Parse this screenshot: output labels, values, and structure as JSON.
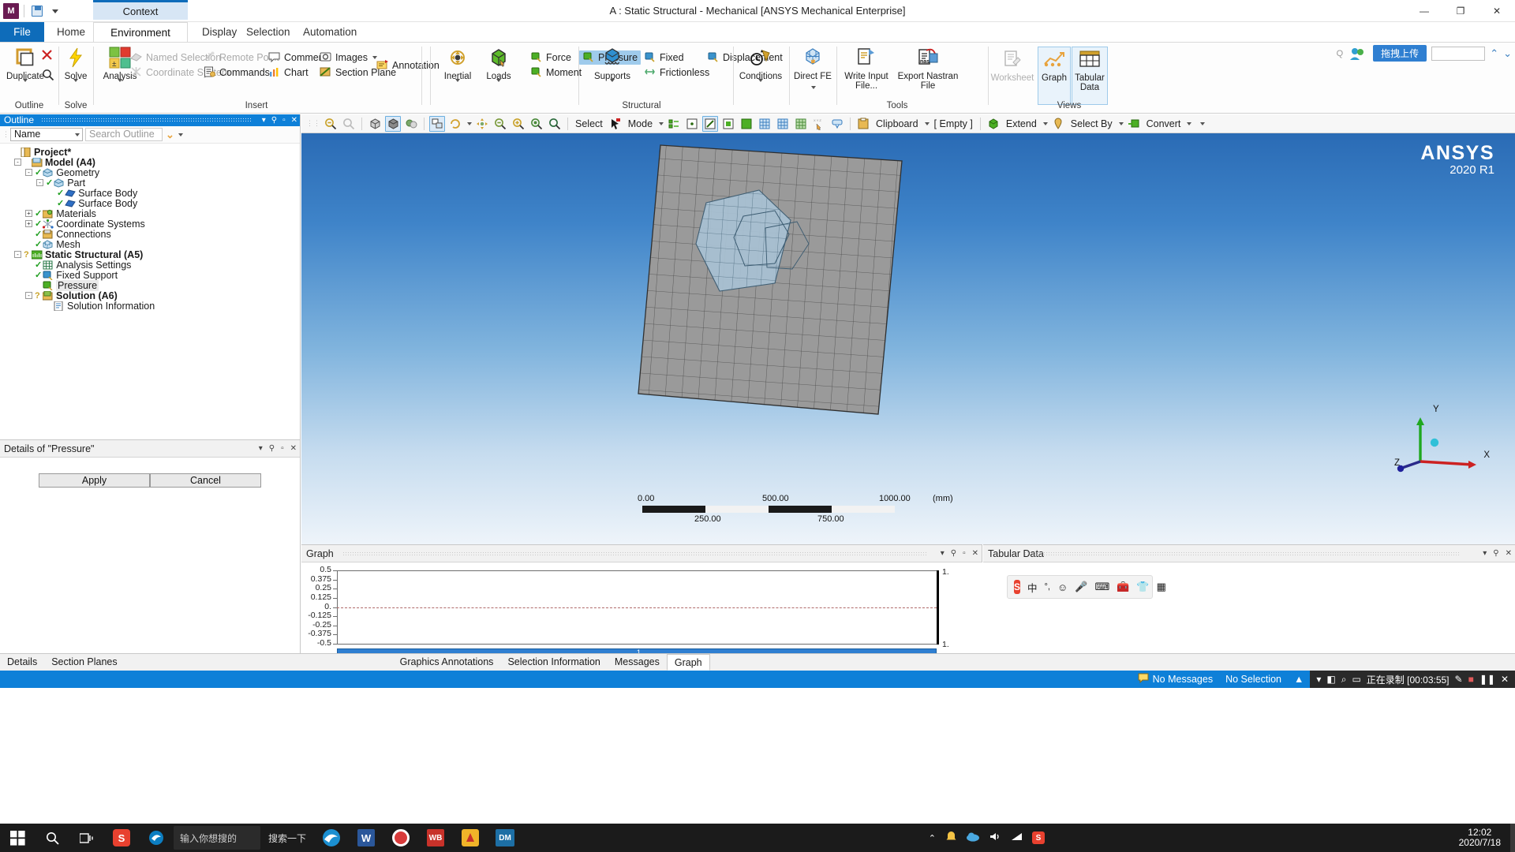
{
  "window": {
    "title": "A : Static Structural - Mechanical [ANSYS Mechanical Enterprise]",
    "context_tab": "Context",
    "minimize": "—",
    "maximize": "❐",
    "close": "✕"
  },
  "ribbon": {
    "tabs": [
      {
        "label": "File",
        "active": false
      },
      {
        "label": "Home",
        "active": false
      },
      {
        "label": "Environment",
        "active": true
      },
      {
        "label": "Display",
        "active": false
      },
      {
        "label": "Selection",
        "active": false
      },
      {
        "label": "Automation",
        "active": false
      }
    ],
    "groups": [
      {
        "label": "Outline"
      },
      {
        "label": "Solve"
      },
      {
        "label": "Insert"
      },
      {
        "label": "Structural"
      },
      {
        "label": "Tools"
      },
      {
        "label": "Views"
      }
    ],
    "outline_group": {
      "duplicate": "Duplicate",
      "delete_icon": "delete-icon",
      "find_icon": "find-icon"
    },
    "solve_group": {
      "solve": "Solve",
      "solve_label": "Solve"
    },
    "insert_group": {
      "analysis": "Analysis",
      "named_selection": "Named Selection",
      "coordinate_system": "Coordinate System",
      "remote_point": "Remote Point",
      "commands": "Commands",
      "comment": "Comment",
      "chart": "Chart",
      "images": "Images",
      "section_plane": "Section Plane",
      "annotation": "Annotation"
    },
    "structural_group": {
      "inertial": "Inertial",
      "loads": "Loads",
      "force": "Force",
      "moment": "Moment",
      "pressure": "Pressure",
      "supports": "Supports",
      "fixed": "Fixed",
      "frictionless": "Frictionless",
      "displacement": "Displacement",
      "conditions": "Conditions",
      "direct_fe": "Direct FE"
    },
    "tools_group": {
      "write_input_file": "Write Input File...",
      "export_nastran_file": "Export Nastran File",
      "nas_badge": ".nas",
      "worksheet": "Worksheet"
    },
    "views_group": {
      "graph": "Graph",
      "tabular_data": "Tabular Data"
    }
  },
  "outline_panel": {
    "title": "Outline",
    "filter_value": "Name",
    "search_placeholder": "Search Outline",
    "tree": [
      {
        "label": "Project*",
        "depth": 0,
        "bold": true,
        "expander": "",
        "status": "",
        "icon": "project-icon"
      },
      {
        "label": "Model (A4)",
        "depth": 1,
        "bold": true,
        "expander": "-",
        "status": "",
        "icon": "model-icon"
      },
      {
        "label": "Geometry",
        "depth": 2,
        "bold": false,
        "expander": "-",
        "status": "check",
        "icon": "geometry-icon"
      },
      {
        "label": "Part",
        "depth": 3,
        "bold": false,
        "expander": "-",
        "status": "check",
        "icon": "part-icon"
      },
      {
        "label": "Surface Body",
        "depth": 4,
        "bold": false,
        "expander": "",
        "status": "check",
        "icon": "surface-body-icon"
      },
      {
        "label": "Surface Body",
        "depth": 4,
        "bold": false,
        "expander": "",
        "status": "check",
        "icon": "surface-body-icon"
      },
      {
        "label": "Materials",
        "depth": 2,
        "bold": false,
        "expander": "+",
        "status": "check",
        "icon": "materials-icon"
      },
      {
        "label": "Coordinate Systems",
        "depth": 2,
        "bold": false,
        "expander": "+",
        "status": "check",
        "icon": "coordinate-systems-icon"
      },
      {
        "label": "Connections",
        "depth": 2,
        "bold": false,
        "expander": "",
        "status": "check",
        "icon": "connections-icon"
      },
      {
        "label": "Mesh",
        "depth": 2,
        "bold": false,
        "expander": "",
        "status": "check",
        "icon": "mesh-icon"
      },
      {
        "label": "Static Structural (A5)",
        "depth": 1,
        "bold": true,
        "expander": "-",
        "status": "question",
        "icon": "static-structural-icon"
      },
      {
        "label": "Analysis Settings",
        "depth": 2,
        "bold": false,
        "expander": "",
        "status": "check",
        "icon": "analysis-settings-icon"
      },
      {
        "label": "Fixed Support",
        "depth": 2,
        "bold": false,
        "expander": "",
        "status": "check",
        "icon": "fixed-support-icon"
      },
      {
        "label": "Pressure",
        "depth": 2,
        "bold": false,
        "expander": "",
        "status": "",
        "icon": "pressure-icon",
        "selected": true
      },
      {
        "label": "Solution (A6)",
        "depth": 2,
        "bold": true,
        "expander": "-",
        "status": "question",
        "icon": "solution-icon"
      },
      {
        "label": "Solution Information",
        "depth": 3,
        "bold": false,
        "expander": "",
        "status": "",
        "icon": "solution-information-icon"
      }
    ]
  },
  "details_panel": {
    "title": "Details of \"Pressure\"",
    "apply_label": "Apply",
    "cancel_label": "Cancel"
  },
  "graphics_toolbar": {
    "select_label": "Select",
    "mode_label": "Mode",
    "clipboard_label": "Clipboard",
    "empty_label": "[ Empty ]",
    "extend_label": "Extend",
    "select_by_label": "Select By",
    "convert_label": "Convert"
  },
  "graphics": {
    "brand_line1": "ANSYS",
    "brand_line2": "2020 R1",
    "axis_x": "X",
    "axis_y": "Y",
    "axis_z": "Z",
    "scale_unit": "(mm)",
    "scale_major": [
      "0.00",
      "500.00",
      "1000.00"
    ],
    "scale_minor": [
      "250.00",
      "750.00"
    ]
  },
  "graph_panel": {
    "title": "Graph",
    "x_right_top": "1.",
    "x_right_bottom": "1.",
    "bar_label": "1"
  },
  "tabular_panel": {
    "title": "Tabular Data"
  },
  "ime": {
    "logo": "S",
    "lang": "中",
    "punct": "°,",
    "emoji": "☺",
    "mic": "mic-icon",
    "keyboard": "keyboard-icon",
    "toolbox": "toolbox-icon",
    "skin": "skin-icon",
    "grid": "grid-icon"
  },
  "bottom_tabs": [
    {
      "label": "Details",
      "active": false
    },
    {
      "label": "Section Planes",
      "active": false
    },
    {
      "label": "Graphics Annotations",
      "active": false
    },
    {
      "label": "Selection Information",
      "active": false
    },
    {
      "label": "Messages",
      "active": false
    },
    {
      "label": "Graph",
      "active": true
    }
  ],
  "status_bar": {
    "messages": "No Messages",
    "selection": "No Selection",
    "recording": "正在录制 [00:03:55]"
  },
  "upload_badge": "拖拽上传",
  "taskbar": {
    "search_placeholder": "输入你想搜的",
    "search_button": "搜索一下",
    "time": "12:02",
    "date": "2020/7/18",
    "apps": [
      "sogou-icon",
      "edge-icon",
      "word-icon",
      "record-icon",
      "wps-icon",
      "ansys-icon",
      "designmodeler-icon"
    ]
  }
}
